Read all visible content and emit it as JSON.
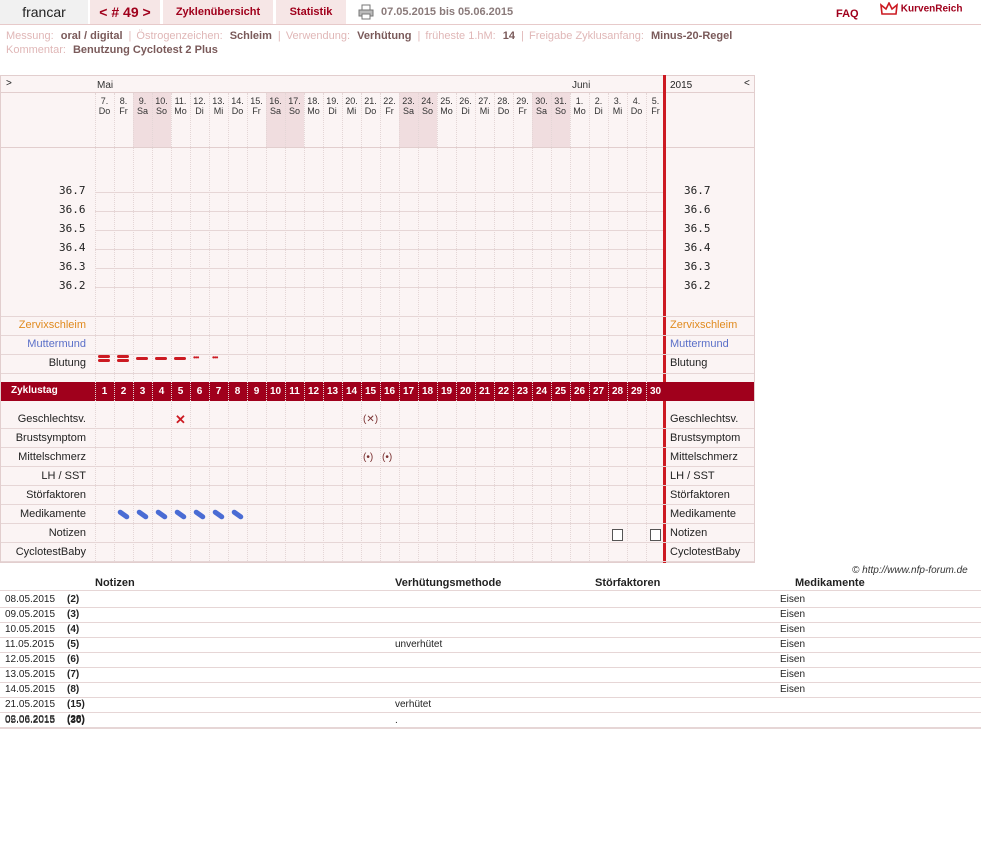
{
  "header": {
    "user": "francar",
    "cycle": "< # 49 >",
    "overview": "Zyklenübersicht",
    "statistics": "Statistik",
    "date_range": "07.05.2015 bis 05.06.2015",
    "faq": "FAQ",
    "logo": "KurvenReich"
  },
  "info": {
    "messung_label": "Messung:",
    "messung": "oral / digital",
    "oestrogen_label": "Östrogenzeichen:",
    "oestrogen": "Schleim",
    "verwendung_label": "Verwendung:",
    "verwendung": "Verhütung",
    "hm_label": "früheste 1.hM:",
    "hm": "14",
    "freigabe_label": "Freigabe Zyklusanfang:",
    "freigabe": "Minus-20-Regel",
    "kommentar_label": "Kommentar:",
    "kommentar": "Benutzung Cyclotest 2 Plus"
  },
  "chart": {
    "nav_left": ">",
    "nav_right": "<",
    "year": "2015",
    "month1": "Mai",
    "month2": "Juni",
    "days": [
      {
        "d": "7.",
        "w": "Do"
      },
      {
        "d": "8.",
        "w": "Fr"
      },
      {
        "d": "9.",
        "w": "Sa"
      },
      {
        "d": "10.",
        "w": "So"
      },
      {
        "d": "11.",
        "w": "Mo"
      },
      {
        "d": "12.",
        "w": "Di"
      },
      {
        "d": "13.",
        "w": "Mi"
      },
      {
        "d": "14.",
        "w": "Do"
      },
      {
        "d": "15.",
        "w": "Fr"
      },
      {
        "d": "16.",
        "w": "Sa"
      },
      {
        "d": "17.",
        "w": "So"
      },
      {
        "d": "18.",
        "w": "Mo"
      },
      {
        "d": "19.",
        "w": "Di"
      },
      {
        "d": "20.",
        "w": "Mi"
      },
      {
        "d": "21.",
        "w": "Do"
      },
      {
        "d": "22.",
        "w": "Fr"
      },
      {
        "d": "23.",
        "w": "Sa"
      },
      {
        "d": "24.",
        "w": "So"
      },
      {
        "d": "25.",
        "w": "Mo"
      },
      {
        "d": "26.",
        "w": "Di"
      },
      {
        "d": "27.",
        "w": "Mi"
      },
      {
        "d": "28.",
        "w": "Do"
      },
      {
        "d": "29.",
        "w": "Fr"
      },
      {
        "d": "30.",
        "w": "Sa"
      },
      {
        "d": "31.",
        "w": "So"
      },
      {
        "d": "1.",
        "w": "Mo"
      },
      {
        "d": "2.",
        "w": "Di"
      },
      {
        "d": "3.",
        "w": "Mi"
      },
      {
        "d": "4.",
        "w": "Do"
      },
      {
        "d": "5.",
        "w": "Fr"
      }
    ],
    "temps": [
      "36.7",
      "36.6",
      "36.5",
      "36.4",
      "36.3",
      "36.2"
    ],
    "rows_top": [
      "Zervixschleim",
      "Muttermund",
      "Blutung"
    ],
    "cycle_label": "Zyklustag",
    "rows_bottom": [
      "Geschlechtsv.",
      "Brustsymptom",
      "Mittelschmerz",
      "LH / SST",
      "Störfaktoren",
      "Medikamente",
      "Notizen",
      "CyclotestBaby"
    ],
    "colors": {
      "accent": "#a0001c",
      "zervix": "#e08a1e",
      "muttermund": "#5a6fc8",
      "redline": "#cc1a22"
    }
  },
  "table": {
    "copyright": "© http://www.nfp-forum.de",
    "headers": {
      "notes": "Notizen",
      "method": "Verhütungsmethode",
      "stoer": "Störfaktoren",
      "med": "Medikamente"
    },
    "rows": [
      {
        "date": "08.05.2015",
        "day": "(2)",
        "method": "",
        "med": "Eisen"
      },
      {
        "date": "09.05.2015",
        "day": "(3)",
        "method": "",
        "med": "Eisen"
      },
      {
        "date": "10.05.2015",
        "day": "(4)",
        "method": "",
        "med": "Eisen"
      },
      {
        "date": "11.05.2015",
        "day": "(5)",
        "method": "unverhütet",
        "med": "Eisen"
      },
      {
        "date": "12.05.2015",
        "day": "(6)",
        "method": "",
        "med": "Eisen"
      },
      {
        "date": "13.05.2015",
        "day": "(7)",
        "method": "",
        "med": "Eisen"
      },
      {
        "date": "14.05.2015",
        "day": "(8)",
        "method": "",
        "med": "Eisen"
      },
      {
        "date": "21.05.2015",
        "day": "(15)",
        "method": "verhütet",
        "med": ""
      },
      {
        "date": "02.06.2015",
        "day": "(28)",
        "method": "",
        "med": ""
      },
      {
        "date": "05.06.2015",
        "day": "(30)",
        "method": ".",
        "med": ""
      }
    ]
  }
}
